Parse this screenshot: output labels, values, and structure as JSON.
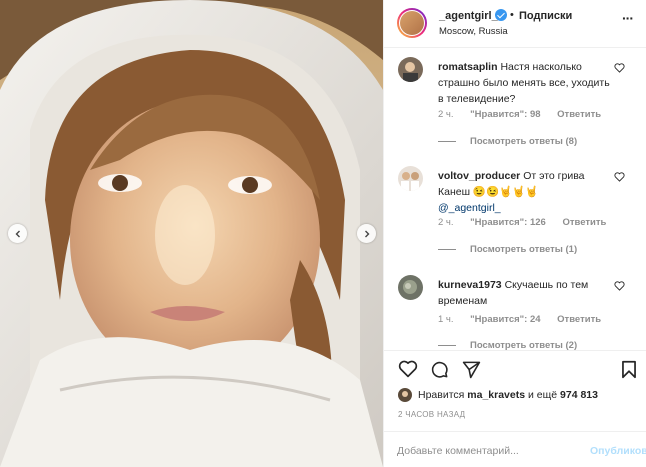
{
  "post": {
    "author": "_agentgirl_",
    "separator": "•",
    "follow_label": "Подписки",
    "location": "Moscow, Russia",
    "photo_alt": "image-photo-portrait"
  },
  "comments": [
    {
      "user": "romatsaplin",
      "text": "Настя насколько страшно было менять все, уходить в телевидение?",
      "age": "2 ч.",
      "likes": "\"Нравится\": 98",
      "reply": "Ответить",
      "view_replies": "Посмотреть ответы (8)"
    },
    {
      "user": "voltov_producer",
      "text": "От это грива Канеш 😉😉🤘🤘🤘",
      "mention": "@_agentgirl_",
      "age": "2 ч.",
      "likes": "\"Нравится\": 126",
      "reply": "Ответить",
      "view_replies": "Посмотреть ответы (1)"
    },
    {
      "user": "kurneva1973",
      "text": "Скучаешь по тем временам",
      "age": "1 ч.",
      "likes": "\"Нравится\": 24",
      "reply": "Ответить",
      "view_replies": "Посмотреть ответы (2)"
    }
  ],
  "likes_summary": {
    "prefix": "Нравится",
    "user": "ma_kravets",
    "middle": "и ещё",
    "count": "974 813"
  },
  "time_ago": "2 ЧАСОВ НАЗАД",
  "composer": {
    "placeholder": "Добавьте комментарий...",
    "post_label": "Опубликовать"
  },
  "colors": {
    "link": "#00376b",
    "muted": "#8e8e8e",
    "post_disabled": "#b2dffc",
    "verified": "#3897f0"
  }
}
